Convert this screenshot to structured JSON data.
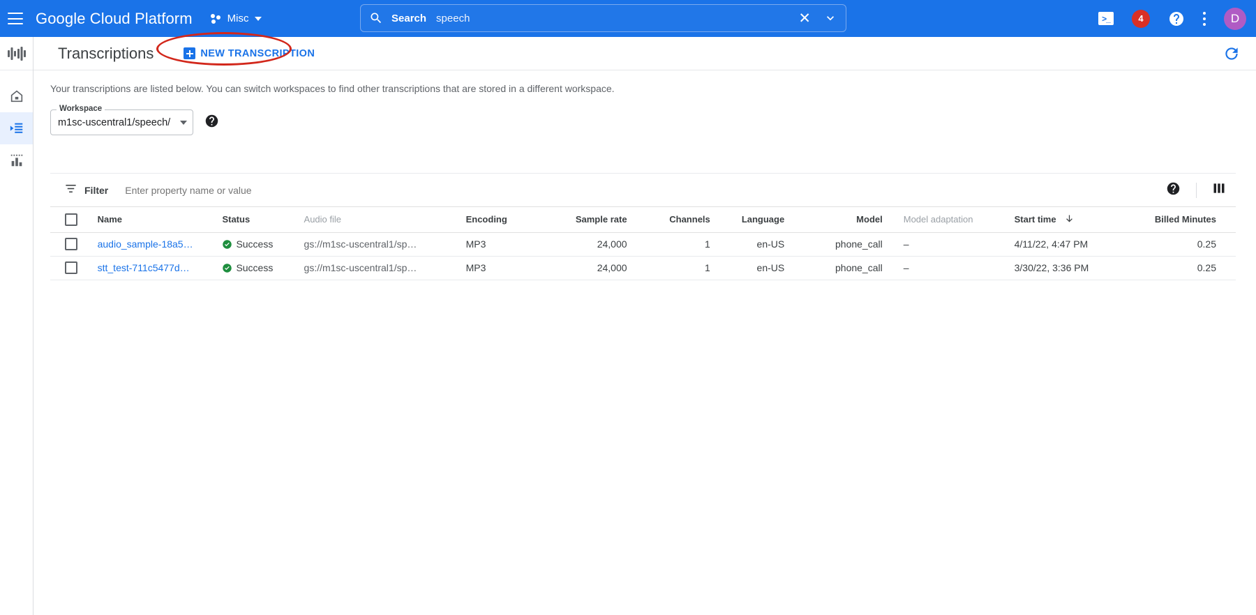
{
  "topbar": {
    "menu_icon": "hamburger-menu-icon",
    "brand": "Google Cloud Platform",
    "project": "Misc",
    "search": {
      "icon": "search-icon",
      "label": "Search",
      "value": "speech",
      "placeholder": "Search",
      "clear_icon": "close-icon",
      "expand_icon": "chevron-down-icon"
    },
    "actions": {
      "terminal_label": ">_",
      "notification_count": "4",
      "help_icon": "help-circle-icon",
      "more_icon": "kebab-menu-icon",
      "avatar_initial": "D"
    }
  },
  "rail": {
    "logo_icon": "audio-waveform-icon",
    "items": [
      {
        "icon": "home-icon",
        "name": "home",
        "active": false
      },
      {
        "icon": "transcriptions-list-icon",
        "name": "transcriptions",
        "active": true
      },
      {
        "icon": "bar-chart-icon",
        "name": "analytics",
        "active": false
      }
    ]
  },
  "page": {
    "title": "Transcriptions",
    "new_button_label": "NEW TRANSCRIPTION",
    "new_button_icon": "plus-square-icon",
    "refresh_icon": "refresh-icon",
    "description": "Your transcriptions are listed below. You can switch workspaces to find other transcriptions that are stored in a different workspace."
  },
  "workspace": {
    "legend": "Workspace",
    "value": "m1sc-uscentral1/speech/",
    "dropdown_icon": "chevron-down-icon",
    "help_icon": "help-circle-icon"
  },
  "filter": {
    "icon": "filter-icon",
    "label": "Filter",
    "placeholder": "Enter property name or value",
    "value": "",
    "help_icon": "help-circle-icon",
    "columns_icon": "column-display-icon"
  },
  "table": {
    "columns": [
      {
        "key": "select",
        "label": "",
        "muted": false
      },
      {
        "key": "name",
        "label": "Name",
        "muted": false
      },
      {
        "key": "status",
        "label": "Status",
        "muted": false
      },
      {
        "key": "audio",
        "label": "Audio file",
        "muted": true
      },
      {
        "key": "encoding",
        "label": "Encoding",
        "muted": false
      },
      {
        "key": "rate",
        "label": "Sample rate",
        "muted": false
      },
      {
        "key": "channels",
        "label": "Channels",
        "muted": false
      },
      {
        "key": "language",
        "label": "Language",
        "muted": false
      },
      {
        "key": "model",
        "label": "Model",
        "muted": false
      },
      {
        "key": "adapt",
        "label": "Model adaptation",
        "muted": true
      },
      {
        "key": "start",
        "label": "Start time",
        "muted": false
      },
      {
        "key": "billed",
        "label": "Billed Minutes",
        "muted": false
      }
    ],
    "sort": {
      "column": "Start time",
      "direction": "descending",
      "icon": "arrow-down-icon"
    },
    "rows": [
      {
        "selected": false,
        "name": "audio_sample-18a5…",
        "status": "Success",
        "status_icon": "check-circle-icon",
        "audio": "gs://m1sc-uscentral1/sp…",
        "encoding": "MP3",
        "rate": "24,000",
        "channels": "1",
        "language": "en-US",
        "model": "phone_call",
        "adapt": "–",
        "start": "4/11/22, 4:47 PM",
        "billed": "0.25"
      },
      {
        "selected": false,
        "name": "stt_test-711c5477d…",
        "status": "Success",
        "status_icon": "check-circle-icon",
        "audio": "gs://m1sc-uscentral1/sp…",
        "encoding": "MP3",
        "rate": "24,000",
        "channels": "1",
        "language": "en-US",
        "model": "phone_call",
        "adapt": "–",
        "start": "3/30/22, 3:36 PM",
        "billed": "0.25"
      }
    ]
  },
  "annotation": {
    "shape": "red-ellipse",
    "target": "new-transcription-button",
    "color": "#d2271b"
  },
  "colors": {
    "brand_blue": "#1a73e8",
    "success_green": "#1e8e3e",
    "badge_red": "#d93025",
    "avatar_purple": "#b05bc4",
    "annotation_red": "#d2271b"
  }
}
